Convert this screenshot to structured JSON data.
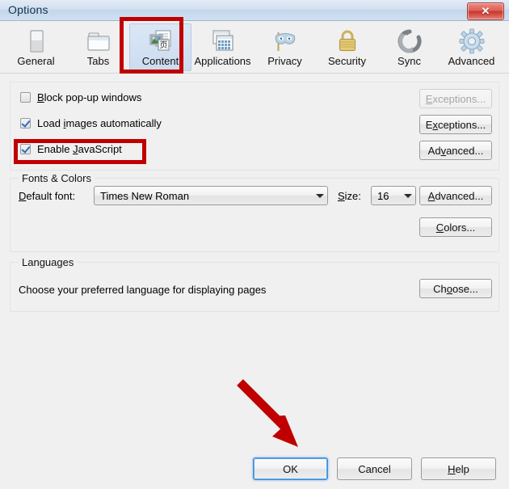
{
  "window": {
    "title": "Options",
    "close_label": "✕"
  },
  "tabs": [
    {
      "label": "General",
      "icon": "general-page-icon",
      "selected": false
    },
    {
      "label": "Tabs",
      "icon": "tabs-folder-icon",
      "selected": false
    },
    {
      "label": "Content",
      "icon": "content-page-icon",
      "selected": true
    },
    {
      "label": "Applications",
      "icon": "applications-grid-icon",
      "selected": false
    },
    {
      "label": "Privacy",
      "icon": "privacy-mask-icon",
      "selected": false
    },
    {
      "label": "Security",
      "icon": "security-padlock-icon",
      "selected": false
    },
    {
      "label": "Sync",
      "icon": "sync-arrows-icon",
      "selected": false
    },
    {
      "label": "Advanced",
      "icon": "advanced-gear-icon",
      "selected": false
    }
  ],
  "content_panel": {
    "checkboxes": [
      {
        "label_pre": "",
        "accel": "B",
        "label_post": "lock pop-up windows",
        "checked": false
      },
      {
        "label_pre": "Load ",
        "accel": "i",
        "label_post": "mages automatically",
        "checked": true
      },
      {
        "label_pre": "Enable ",
        "accel": "J",
        "label_post": "avaScript",
        "checked": true
      }
    ],
    "buttons": [
      {
        "label_pre": "",
        "accel": "E",
        "label_post": "xceptions...",
        "disabled": true
      },
      {
        "label_pre": "E",
        "accel": "x",
        "label_post": "ceptions...",
        "disabled": false
      },
      {
        "label_pre": "Ad",
        "accel": "v",
        "label_post": "anced...",
        "disabled": false
      }
    ]
  },
  "fonts_colors": {
    "group_title": "Fonts & Colors",
    "default_font_label_pre": "",
    "default_font_accel": "D",
    "default_font_label_post": "efault font:",
    "default_font_value": "Times New Roman",
    "size_label_pre": "",
    "size_accel": "S",
    "size_label_post": "ize:",
    "size_value": "16",
    "advanced_pre": "",
    "advanced_accel": "A",
    "advanced_post": "dvanced...",
    "colors_pre": "",
    "colors_accel": "C",
    "colors_post": "olors..."
  },
  "languages": {
    "group_title": "Languages",
    "description": "Choose your preferred language for displaying pages",
    "choose_pre": "Ch",
    "choose_accel": "o",
    "choose_post": "ose..."
  },
  "dialog_buttons": {
    "ok": "OK",
    "cancel": "Cancel",
    "help_pre": "",
    "help_accel": "H",
    "help_post": "elp"
  },
  "annotations": {
    "highlight_color": "#c00000",
    "arrow_color": "#c00000",
    "highlighted_tab": "Content",
    "highlighted_checkbox": "Enable JavaScript",
    "arrow_points_to": "OK"
  },
  "colors": {
    "window_background": "#f0f0f0",
    "titlebar": "#cfe0f1",
    "selected_tab": "#cbdcf0",
    "checkmark": "#2a6ec0",
    "close_button": "#c8352a",
    "default_button_focus": "#3c8ddc"
  }
}
